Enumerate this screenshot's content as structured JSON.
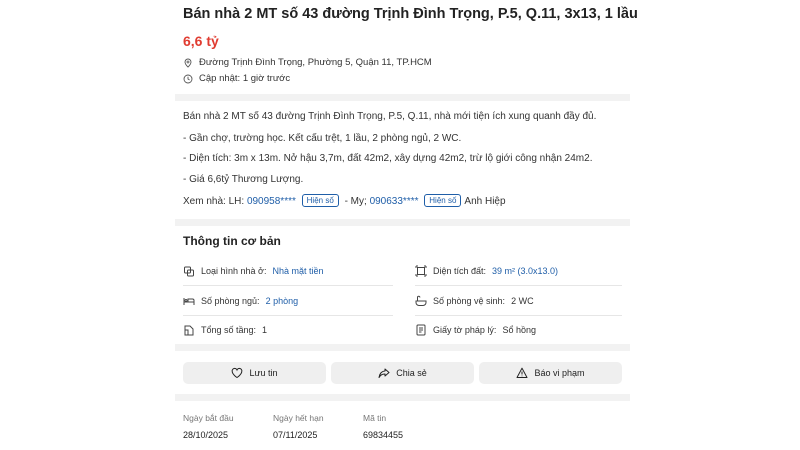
{
  "listing": {
    "title": "Bán nhà 2 MT số 43 đường Trịnh Đình Trọng, P.5, Q.11, 3x13, 1 lầu",
    "price": "6,6 tỷ",
    "address": "Đường Trịnh Đình Trọng, Phường 5, Quận 11, TP.HCM",
    "updated": "Cập nhật: 1 giờ trước"
  },
  "description": {
    "line1": "Bán nhà 2 MT số 43 đường Trịnh Đình Trọng, P.5, Q.11, nhà mới tiện ích xung quanh đầy đủ.",
    "line2": "- Gần chợ, trường học. Kết cấu trệt, 1 lầu, 2 phòng ngủ, 2 WC.",
    "line3": "- Diện tích: 3m x 13m. Nở hậu 3,7m, đất 42m2, xây dựng 42m2, trừ lộ giới công nhận 24m2.",
    "line4": "- Giá 6,6tỷ Thương Lượng.",
    "contact_prefix": "Xem nhà: LH:",
    "phone1": "090958****",
    "reveal_label": "Hiện số",
    "contact_mid": "- My;",
    "phone2": "090633****",
    "contact_suffix": "Anh Hiệp"
  },
  "basic_info": {
    "heading": "Thông tin cơ bản",
    "items": [
      {
        "label": "Loại hình nhà ở:",
        "value": "Nhà mặt tiền",
        "icon": "house-type-icon"
      },
      {
        "label": "Diện tích đất:",
        "value": "39 m² (3.0x13.0)",
        "icon": "area-icon"
      },
      {
        "label": "Số phòng ngủ:",
        "value": "2 phòng",
        "icon": "bed-icon"
      },
      {
        "label": "Số phòng vệ sinh:",
        "value": "2 WC",
        "icon": "bath-icon"
      },
      {
        "label": "Tổng số tầng:",
        "value": "1",
        "icon": "floors-icon"
      },
      {
        "label": "Giấy tờ pháp lý:",
        "value": "Sổ hồng",
        "icon": "document-icon"
      }
    ]
  },
  "actions": {
    "save": "Lưu tin",
    "share": "Chia sẻ",
    "report": "Báo vi phạm"
  },
  "footer": {
    "start_label": "Ngày bắt đầu",
    "start_value": "28/10/2025",
    "end_label": "Ngày hết hạn",
    "end_value": "07/11/2025",
    "id_label": "Mã tin",
    "id_value": "69834455"
  }
}
